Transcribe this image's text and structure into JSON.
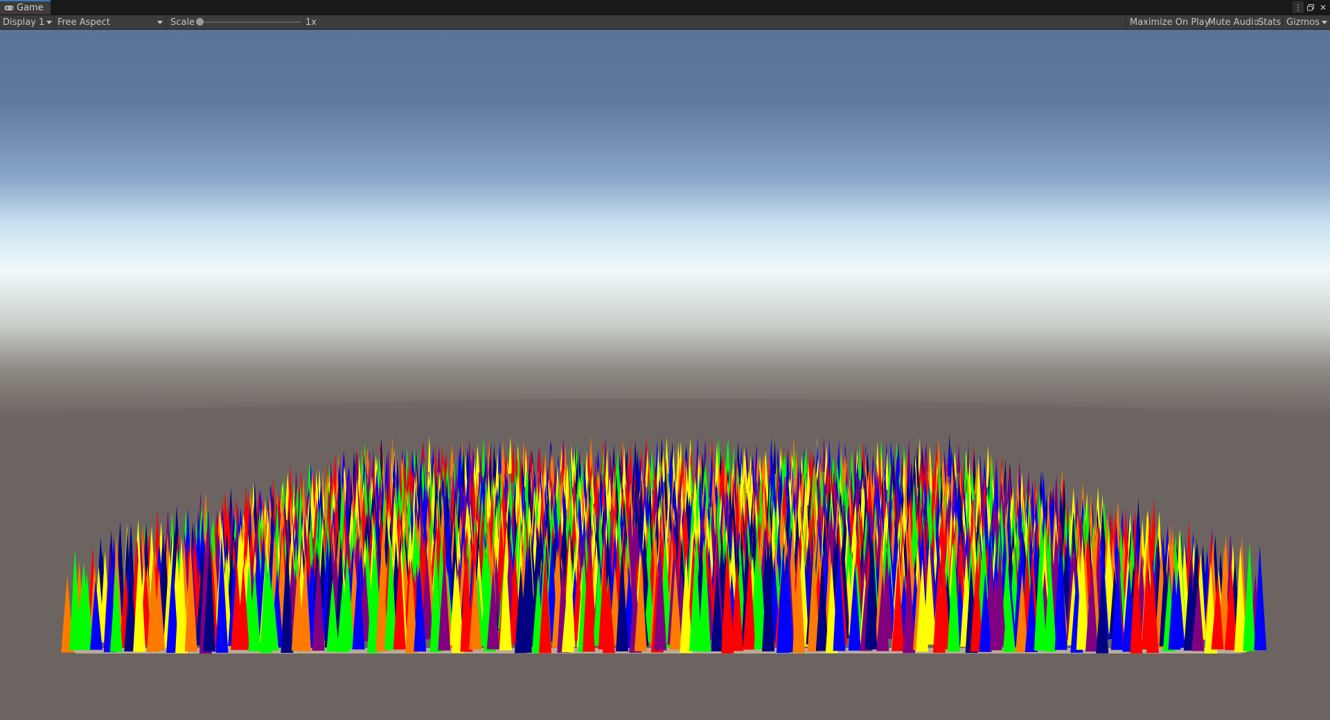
{
  "window": {
    "tab_label": "Game",
    "tab_icon": "gamepad-icon"
  },
  "toolbar": {
    "display_label": "Display 1",
    "aspect_label": "Free Aspect",
    "scale_label": "Scale",
    "scale_value": "1x",
    "maximize_label": "Maximize On Play",
    "mute_label": "Mute Audio",
    "stats_label": "Stats",
    "gizmos_label": "Gizmos"
  },
  "scene": {
    "sky_top": "#5a7399",
    "horizon": "#eef7fb",
    "ground": "#6c6460",
    "plane": "#b7ab98",
    "cone_colors": [
      "#ff0000",
      "#ff7a00",
      "#ffff00",
      "#00ff00",
      "#0000ff",
      "#000080",
      "#800080"
    ]
  }
}
